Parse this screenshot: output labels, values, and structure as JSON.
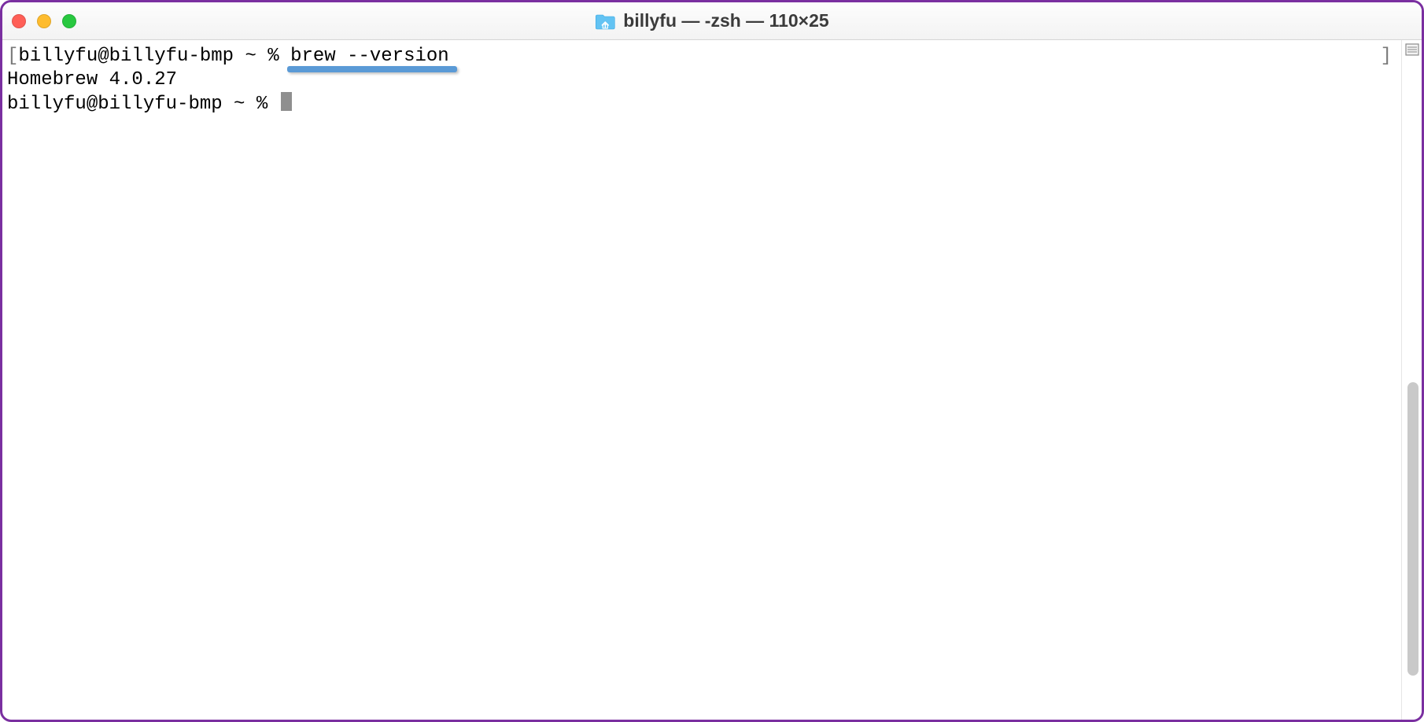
{
  "window": {
    "title": "billyfu — -zsh — 110×25",
    "folder_icon": "home-folder-icon"
  },
  "traffic_lights": {
    "close": "close",
    "minimize": "minimize",
    "zoom": "zoom"
  },
  "terminal": {
    "lines": [
      {
        "prefix": "[",
        "prompt": "billyfu@billyfu-bmp ~ % ",
        "command": "brew --version",
        "suffix": "",
        "underline": true
      },
      {
        "prefix": "",
        "prompt": "",
        "command": "",
        "suffix": "",
        "output": "Homebrew 4.0.27"
      },
      {
        "prefix": "",
        "prompt": "billyfu@billyfu-bmp ~ % ",
        "command": "",
        "suffix": "",
        "cursor": true
      }
    ],
    "right_bracket_line0": "]"
  },
  "scrollbar": {
    "thumb_top_pct": 49,
    "thumb_height_pct": 45
  }
}
